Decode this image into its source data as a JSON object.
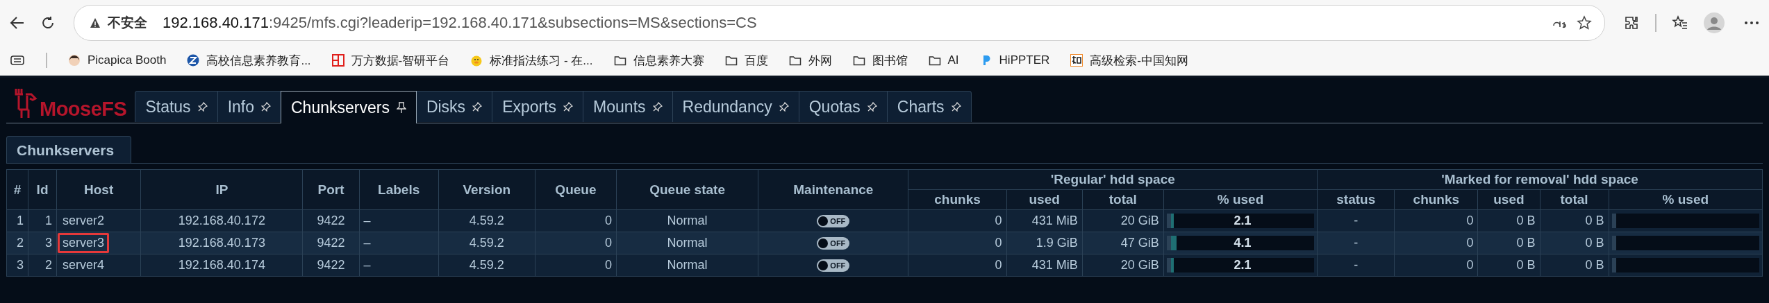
{
  "browser": {
    "address": {
      "security": "不安全",
      "host": "192.168.40.171",
      "rest": ":9425/mfs.cgi?leaderip=192.168.40.171&subsections=MS&sections=CS"
    },
    "bookmarks": [
      {
        "kind": "person",
        "label": "Picapica Booth"
      },
      {
        "kind": "z",
        "label": "高校信息素养教育..."
      },
      {
        "kind": "grid",
        "label": "万方数据-智研平台"
      },
      {
        "kind": "duck",
        "label": "标准指法练习 - 在..."
      },
      {
        "kind": "folder",
        "label": "信息素养大赛"
      },
      {
        "kind": "folder",
        "label": "百度"
      },
      {
        "kind": "folder",
        "label": "外网"
      },
      {
        "kind": "folder",
        "label": "图书馆"
      },
      {
        "kind": "folder",
        "label": "AI"
      },
      {
        "kind": "p",
        "label": "HiPPTER"
      },
      {
        "kind": "zhi",
        "label": "高级检索-中国知网"
      }
    ]
  },
  "app": {
    "logo": "MooseFS",
    "tabs": [
      {
        "label": "Status",
        "selected": false
      },
      {
        "label": "Info",
        "selected": false
      },
      {
        "label": "Chunkservers",
        "selected": true
      },
      {
        "label": "Disks",
        "selected": false
      },
      {
        "label": "Exports",
        "selected": false
      },
      {
        "label": "Mounts",
        "selected": false
      },
      {
        "label": "Redundancy",
        "selected": false
      },
      {
        "label": "Quotas",
        "selected": false
      },
      {
        "label": "Charts",
        "selected": false
      }
    ],
    "section_tab": "Chunkservers",
    "table": {
      "columns": [
        "#",
        "Id",
        "Host",
        "IP",
        "Port",
        "Labels",
        "Version",
        "Queue",
        "Queue state",
        "Maintenance"
      ],
      "groups": [
        {
          "title": "'Regular' hdd space",
          "columns": [
            "chunks",
            "used",
            "total",
            "% used"
          ]
        },
        {
          "title": "'Marked for removal' hdd space",
          "columns": [
            "status",
            "chunks",
            "used",
            "total",
            "% used"
          ]
        }
      ],
      "rows": [
        {
          "index": "1",
          "id": "1",
          "host": "server2",
          "highlighted": false,
          "ip": "192.168.40.172",
          "port": "9422",
          "labels": "–",
          "version": "4.59.2",
          "queue": "0",
          "queue_state": "Normal",
          "maintenance": {
            "on": false,
            "label": "OFF"
          },
          "regular": {
            "chunks": "0",
            "used": "431 MiB",
            "total": "20 GiB",
            "percent": "2.1",
            "level": 0.021
          },
          "removal": {
            "status": "-",
            "chunks": "0",
            "used": "0 B",
            "total": "0 B"
          }
        },
        {
          "index": "2",
          "id": "3",
          "host": "server3",
          "highlighted": true,
          "ip": "192.168.40.173",
          "port": "9422",
          "labels": "–",
          "version": "4.59.2",
          "queue": "0",
          "queue_state": "Normal",
          "maintenance": {
            "on": false,
            "label": "OFF"
          },
          "regular": {
            "chunks": "0",
            "used": "1.9 GiB",
            "total": "47 GiB",
            "percent": "4.1",
            "level": 0.041
          },
          "removal": {
            "status": "-",
            "chunks": "0",
            "used": "0 B",
            "total": "0 B"
          }
        },
        {
          "index": "3",
          "id": "2",
          "host": "server4",
          "highlighted": false,
          "ip": "192.168.40.174",
          "port": "9422",
          "labels": "–",
          "version": "4.59.2",
          "queue": "0",
          "queue_state": "Normal",
          "maintenance": {
            "on": false,
            "label": "OFF"
          },
          "regular": {
            "chunks": "0",
            "used": "431 MiB",
            "total": "20 GiB",
            "percent": "2.1",
            "level": 0.021
          },
          "removal": {
            "status": "-",
            "chunks": "0",
            "used": "0 B",
            "total": "0 B"
          }
        }
      ]
    }
  }
}
